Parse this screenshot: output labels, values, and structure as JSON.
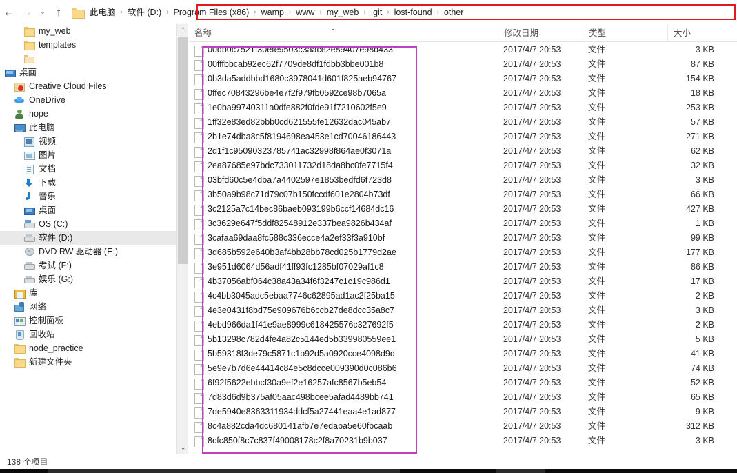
{
  "window": {
    "status_text": "138 个项目"
  },
  "nav": {
    "back_icon": "←",
    "forward_icon": "→",
    "history_icon": "⌄",
    "up_icon": "↑",
    "breadcrumb": [
      "此电脑",
      "软件 (D:)",
      "Program Files (x86)",
      "wamp",
      "www",
      "my_web",
      ".git",
      "lost-found",
      "other"
    ],
    "separator": "›"
  },
  "annotations": {
    "breadcrumb_box_color": "#e01b1b",
    "filelist_box_color": "#c13fc1"
  },
  "sidebar": {
    "items": [
      {
        "label": "my_web",
        "icon": "folder-icon",
        "indent": 2,
        "selected": false
      },
      {
        "label": "templates",
        "icon": "folder-icon",
        "indent": 2,
        "selected": false
      },
      {
        "label": "",
        "icon": "folder-open-icon",
        "indent": 2,
        "selected": false
      },
      {
        "label": "桌面",
        "icon": "desktop-icon",
        "indent": 0,
        "selected": false
      },
      {
        "label": "Creative Cloud Files",
        "icon": "creative-cloud-icon",
        "indent": 1,
        "selected": false
      },
      {
        "label": "OneDrive",
        "icon": "cloud-icon",
        "indent": 1,
        "selected": false
      },
      {
        "label": "hope",
        "icon": "user-icon",
        "indent": 1,
        "selected": false
      },
      {
        "label": "此电脑",
        "icon": "this-pc-icon",
        "indent": 1,
        "selected": false
      },
      {
        "label": "视频",
        "icon": "video-icon",
        "indent": 2,
        "selected": false
      },
      {
        "label": "图片",
        "icon": "pictures-icon",
        "indent": 2,
        "selected": false
      },
      {
        "label": "文档",
        "icon": "documents-icon",
        "indent": 2,
        "selected": false
      },
      {
        "label": "下载",
        "icon": "downloads-icon",
        "indent": 2,
        "selected": false
      },
      {
        "label": "音乐",
        "icon": "music-icon",
        "indent": 2,
        "selected": false
      },
      {
        "label": "桌面",
        "icon": "desktop-icon",
        "indent": 2,
        "selected": false
      },
      {
        "label": "OS (C:)",
        "icon": "drive-os-icon",
        "indent": 2,
        "selected": false
      },
      {
        "label": "软件 (D:)",
        "icon": "drive-icon",
        "indent": 2,
        "selected": true
      },
      {
        "label": "DVD RW 驱动器 (E:)",
        "icon": "dvd-drive-icon",
        "indent": 2,
        "selected": false
      },
      {
        "label": "考试 (F:)",
        "icon": "drive-icon",
        "indent": 2,
        "selected": false
      },
      {
        "label": "娱乐 (G:)",
        "icon": "drive-icon",
        "indent": 2,
        "selected": false
      },
      {
        "label": "库",
        "icon": "library-icon",
        "indent": 1,
        "selected": false
      },
      {
        "label": "网络",
        "icon": "network-icon",
        "indent": 1,
        "selected": false
      },
      {
        "label": "控制面板",
        "icon": "control-panel-icon",
        "indent": 1,
        "selected": false
      },
      {
        "label": "回收站",
        "icon": "recycle-bin-icon",
        "indent": 1,
        "selected": false
      },
      {
        "label": "node_practice",
        "icon": "folder-icon",
        "indent": 1,
        "selected": false
      },
      {
        "label": "新建文件夹",
        "icon": "folder-icon",
        "indent": 1,
        "selected": false
      }
    ]
  },
  "filelist": {
    "columns": [
      "名称",
      "修改日期",
      "类型",
      "大小"
    ],
    "sort_indicator": "⌃",
    "rows": [
      {
        "name": "00db0c7521f30efe9503c3aace2e89407e98d433",
        "date": "2017/4/7 20:53",
        "type": "文件",
        "size": "3 KB"
      },
      {
        "name": "00fffbbcab92ec62f7709de8df1fdbb3bbe001b8",
        "date": "2017/4/7 20:53",
        "type": "文件",
        "size": "87 KB"
      },
      {
        "name": "0b3da5addbbd1680c3978041d601f825aeb94767",
        "date": "2017/4/7 20:53",
        "type": "文件",
        "size": "154 KB"
      },
      {
        "name": "0ffec70843296be4e7f2f979fb0592ce98b7065a",
        "date": "2017/4/7 20:53",
        "type": "文件",
        "size": "18 KB"
      },
      {
        "name": "1e0ba99740311a0dfe882f0fde91f7210602f5e9",
        "date": "2017/4/7 20:53",
        "type": "文件",
        "size": "253 KB"
      },
      {
        "name": "1ff32e83ed82bbb0cd621555fe12632dac045ab7",
        "date": "2017/4/7 20:53",
        "type": "文件",
        "size": "57 KB"
      },
      {
        "name": "2b1e74dba8c5f8194698ea453e1cd70046186443",
        "date": "2017/4/7 20:53",
        "type": "文件",
        "size": "271 KB"
      },
      {
        "name": "2d1f1c95090323785741ac32998f864ae0f3071a",
        "date": "2017/4/7 20:53",
        "type": "文件",
        "size": "62 KB"
      },
      {
        "name": "2ea87685e97bdc733011732d18da8bc0fe7715f4",
        "date": "2017/4/7 20:53",
        "type": "文件",
        "size": "32 KB"
      },
      {
        "name": "03bfd60c5e4dba7a4402597e1853bedfd6f723d8",
        "date": "2017/4/7 20:53",
        "type": "文件",
        "size": "3 KB"
      },
      {
        "name": "3b50a9b98c71d79c07b150fccdf601e2804b73df",
        "date": "2017/4/7 20:53",
        "type": "文件",
        "size": "66 KB"
      },
      {
        "name": "3c2125a7c14bec86baeb093199b6ccf14684dc16",
        "date": "2017/4/7 20:53",
        "type": "文件",
        "size": "427 KB"
      },
      {
        "name": "3c3629e647f5ddf82548912e337bea9826b434af",
        "date": "2017/4/7 20:53",
        "type": "文件",
        "size": "1 KB"
      },
      {
        "name": "3cafaa69daa8fc588c336ecce4a2ef33f3a910bf",
        "date": "2017/4/7 20:53",
        "type": "文件",
        "size": "99 KB"
      },
      {
        "name": "3d685b592e640b3af4bb28bb78cd025b1779d2ae",
        "date": "2017/4/7 20:53",
        "type": "文件",
        "size": "177 KB"
      },
      {
        "name": "3e951d6064d56adf41ff93fc1285bf07029af1c8",
        "date": "2017/4/7 20:53",
        "type": "文件",
        "size": "86 KB"
      },
      {
        "name": "4b37056abf064c38a43a34f6f3247c1c19c986d1",
        "date": "2017/4/7 20:53",
        "type": "文件",
        "size": "17 KB"
      },
      {
        "name": "4c4bb3045adc5ebaa7746c62895ad1ac2f25ba15",
        "date": "2017/4/7 20:53",
        "type": "文件",
        "size": "2 KB"
      },
      {
        "name": "4e3e0431f8bd75e909676b6ccb27de8dcc35a8c7",
        "date": "2017/4/7 20:53",
        "type": "文件",
        "size": "3 KB"
      },
      {
        "name": "4ebd966da1f41e9ae8999c618425576c327692f5",
        "date": "2017/4/7 20:53",
        "type": "文件",
        "size": "2 KB"
      },
      {
        "name": "5b13298c782d4fe4a82c5144ed5b339980559ee1",
        "date": "2017/4/7 20:53",
        "type": "文件",
        "size": "5 KB"
      },
      {
        "name": "5b59318f3de79c5871c1b92d5a0920cce4098d9d",
        "date": "2017/4/7 20:53",
        "type": "文件",
        "size": "41 KB"
      },
      {
        "name": "5e9e7b7d6e44414c84e5c8dcce009390d0c086b6",
        "date": "2017/4/7 20:53",
        "type": "文件",
        "size": "74 KB"
      },
      {
        "name": "6f92f5622ebbcf30a9ef2e16257afc8567b5eb54",
        "date": "2017/4/7 20:53",
        "type": "文件",
        "size": "52 KB"
      },
      {
        "name": "7d83d6d9b375af05aac498bcee5afad4489bb741",
        "date": "2017/4/7 20:53",
        "type": "文件",
        "size": "65 KB"
      },
      {
        "name": "7de5940e8363311934ddcf5a27441eaa4e1ad877",
        "date": "2017/4/7 20:53",
        "type": "文件",
        "size": "9 KB"
      },
      {
        "name": "8c4a882cda4dc680141afb7e7edaba5e60fbcaab",
        "date": "2017/4/7 20:53",
        "type": "文件",
        "size": "312 KB"
      },
      {
        "name": "8cfc850f8c7c837f49008178c2f8a70231b9b037",
        "date": "2017/4/7 20:53",
        "type": "文件",
        "size": "3 KB"
      }
    ]
  }
}
